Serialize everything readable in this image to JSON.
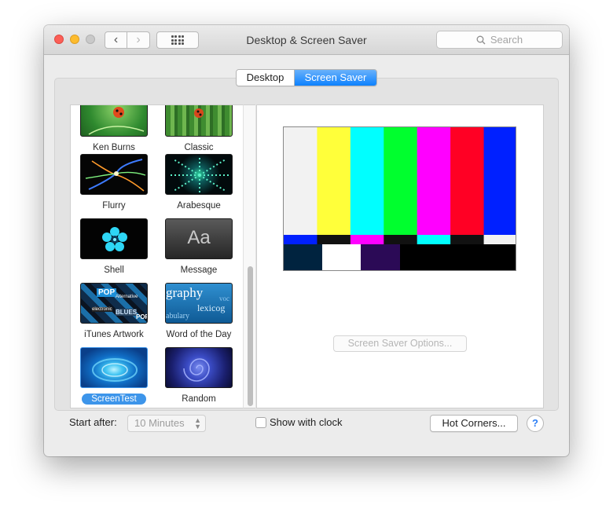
{
  "window": {
    "title": "Desktop & Screen Saver",
    "search_placeholder": "Search"
  },
  "tabs": [
    {
      "label": "Desktop",
      "active": false
    },
    {
      "label": "Screen Saver",
      "active": true
    }
  ],
  "savers": [
    {
      "name": "Ken Burns",
      "icon": "ken-burns-thumbnail",
      "selected": false
    },
    {
      "name": "Classic",
      "icon": "classic-thumbnail",
      "selected": false
    },
    {
      "name": "Flurry",
      "icon": "flurry-thumbnail",
      "selected": false
    },
    {
      "name": "Arabesque",
      "icon": "arabesque-thumbnail",
      "selected": false
    },
    {
      "name": "Shell",
      "icon": "shell-thumbnail",
      "selected": false
    },
    {
      "name": "Message",
      "icon": "message-thumbnail",
      "selected": false,
      "thumb_text": "Aa"
    },
    {
      "name": "iTunes Artwork",
      "icon": "itunes-artwork-thumbnail",
      "selected": false,
      "thumb_words": [
        "POP",
        "Alternative",
        "electronic",
        "BLUES",
        "POP"
      ]
    },
    {
      "name": "Word of the Day",
      "icon": "word-of-the-day-thumbnail",
      "selected": false,
      "thumb_words": [
        "graphy",
        "voc",
        "lexicog",
        "abulary"
      ]
    },
    {
      "name": "ScreenTest",
      "icon": "screentest-thumbnail",
      "selected": true
    },
    {
      "name": "Random",
      "icon": "random-thumbnail",
      "selected": false
    }
  ],
  "preview": {
    "top_bars": [
      "#f2f2f2",
      "#ffff3a",
      "#00ffff",
      "#00ff2e",
      "#ff00ff",
      "#ff0024",
      "#0020ff"
    ],
    "mid_bars": [
      "#0020ff",
      "#111111",
      "#ff00ff",
      "#111111",
      "#00ffff",
      "#111111",
      "#f2f2f2"
    ],
    "bottom_bars": [
      "#00233f",
      "#ffffff",
      "#2b0a56",
      "#000000",
      "#000000",
      "#000000"
    ],
    "options_label": "Screen Saver Options..."
  },
  "bottom": {
    "start_after_label": "Start after:",
    "start_after_value": "10 Minutes",
    "show_clock_label": "Show with clock",
    "show_clock_checked": false,
    "hot_corners_label": "Hot Corners...",
    "help_label": "?"
  }
}
